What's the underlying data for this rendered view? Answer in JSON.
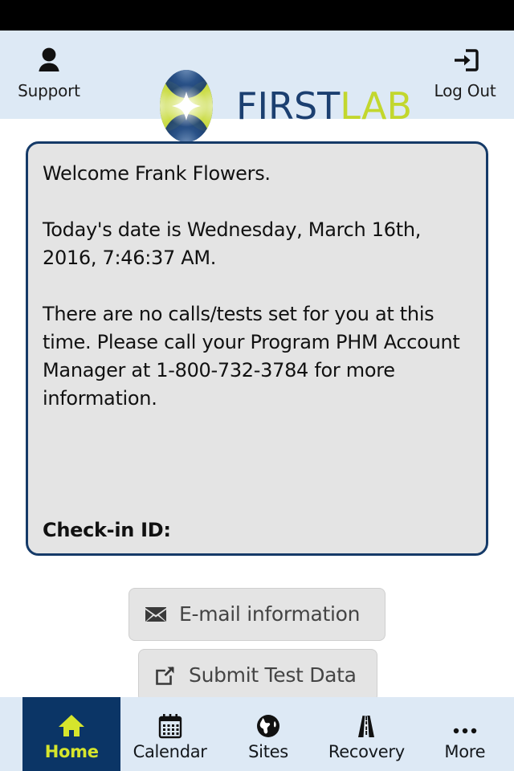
{
  "header": {
    "support": {
      "label": "Support",
      "icon": "user-icon"
    },
    "logout": {
      "label": "Log Out",
      "icon": "logout-icon"
    },
    "logo": {
      "first": "FIRST",
      "lab": "LAB",
      "icon": "firstlab-logo-icon"
    },
    "bg_color": "#dde9f5"
  },
  "panel": {
    "greeting": "Welcome Frank Flowers.",
    "date_line": "Today's date is Wednesday, March 16th, 2016, 7:46:37 AM.",
    "message": "There are no calls/tests set for you at this time. Please call your Program PHM Account Manager at 1-800-732-3784 for more information.",
    "body": "Welcome Frank Flowers.\n\nToday's date is Wednesday, March 16th, 2016, 7:46:37 AM.\n\nThere are no calls/tests set for you at this time. Please call your Program PHM Account Manager at 1-800-732-3784 for more information.",
    "checkin_label": "Check-in ID:",
    "checkin_value": "",
    "border_color": "#153a68",
    "bg_color": "#e4e4e4"
  },
  "actions": [
    {
      "label": "E-mail information",
      "icon": "envelope-icon"
    },
    {
      "label": "Submit Test Data",
      "icon": "external-link-icon"
    }
  ],
  "tabbar": {
    "active_color": "#0b3566",
    "active_text_color": "#d6e52c",
    "items": [
      {
        "label": "Home",
        "icon": "home-icon",
        "active": true
      },
      {
        "label": "Calendar",
        "icon": "calendar-icon",
        "active": false
      },
      {
        "label": "Sites",
        "icon": "globe-icon",
        "active": false
      },
      {
        "label": "Recovery",
        "icon": "road-icon",
        "active": false
      },
      {
        "label": "More",
        "icon": "ellipsis-icon",
        "active": false
      }
    ]
  }
}
